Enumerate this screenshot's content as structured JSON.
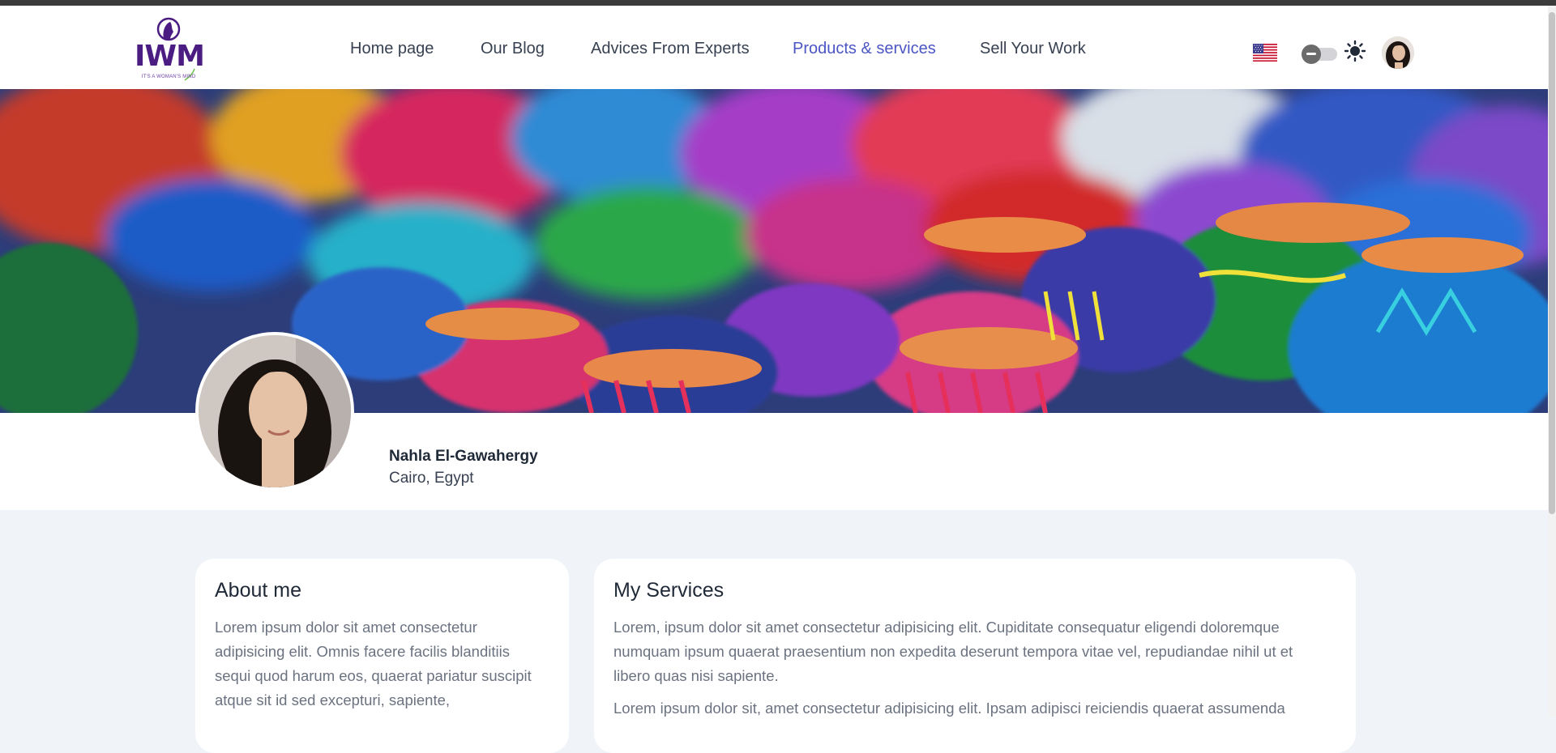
{
  "brand": {
    "logo_text": "IWM",
    "logo_tagline": "IT'S A WOMAN'S MIND"
  },
  "nav": {
    "items": [
      {
        "label": "Home page",
        "active": false
      },
      {
        "label": "Our Blog",
        "active": false
      },
      {
        "label": "Advices From Experts",
        "active": false
      },
      {
        "label": "Products & services",
        "active": true
      },
      {
        "label": "Sell Your Work",
        "active": false
      }
    ]
  },
  "header_icons": {
    "language_flag": "us-flag-icon",
    "theme_toggle": "theme-toggle",
    "theme_icon": "sun-icon",
    "user_avatar": "user-avatar"
  },
  "profile": {
    "name": "Nahla El-Gawahergy",
    "location": "Cairo, Egypt"
  },
  "about": {
    "title": "About me",
    "text": "Lorem ipsum dolor sit amet consectetur adipisicing elit. Omnis facere facilis blanditiis sequi quod harum eos, quaerat pariatur suscipit atque sit id sed excepturi, sapiente,"
  },
  "services": {
    "title": "My Services",
    "paragraph1": "Lorem, ipsum dolor sit amet consectetur adipisicing elit. Cupiditate consequatur eligendi doloremque numquam ipsum quaerat praesentium non expedita deserunt tempora vitae vel, repudiandae nihil ut et libero quas nisi sapiente.",
    "paragraph2": "Lorem ipsum dolor sit, amet consectetur adipisicing elit. Ipsam adipisci reiciendis quaerat assumenda"
  },
  "colors": {
    "accent": "#4c55c4",
    "brand_purple": "#4b1d82",
    "page_bg": "#f0f3f7"
  }
}
